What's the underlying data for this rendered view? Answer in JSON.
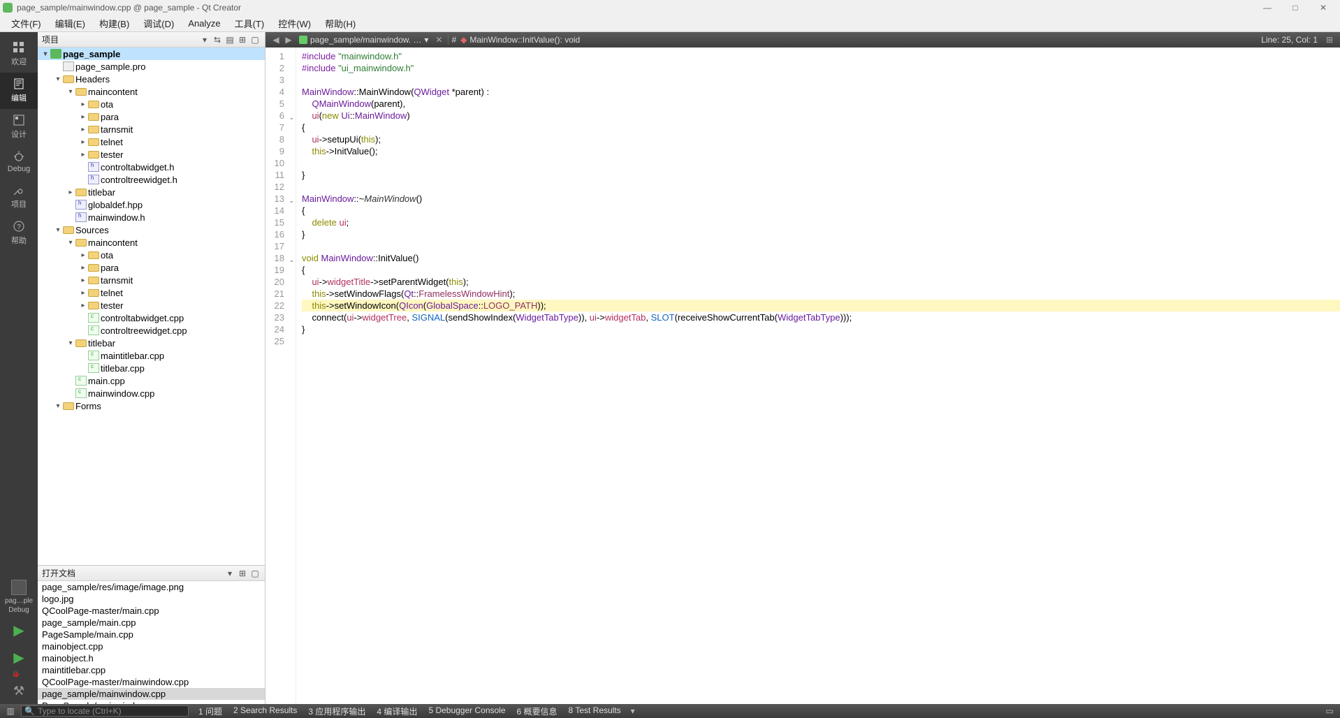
{
  "titlebar": {
    "title": "page_sample/mainwindow.cpp @ page_sample - Qt Creator"
  },
  "menubar": {
    "items": [
      "文件(F)",
      "编辑(E)",
      "构建(B)",
      "调试(D)",
      "Analyze",
      "工具(T)",
      "控件(W)",
      "帮助(H)"
    ]
  },
  "mode_sidebar": {
    "items": [
      {
        "label": "欢迎",
        "icon": "grid"
      },
      {
        "label": "编辑",
        "icon": "edit",
        "active": true
      },
      {
        "label": "设计",
        "icon": "design"
      },
      {
        "label": "Debug",
        "icon": "bug"
      },
      {
        "label": "项目",
        "icon": "wrench"
      },
      {
        "label": "帮助",
        "icon": "help"
      }
    ],
    "kit": {
      "line1": "pag…ple",
      "line2": "",
      "line3": "Debug"
    },
    "run": "run",
    "rundebug": "rundebug",
    "build": "build"
  },
  "project_panel": {
    "title": "项目",
    "tree": [
      {
        "indent": 0,
        "twist": "▾",
        "icon": "proj",
        "label": "page_sample",
        "selected": true
      },
      {
        "indent": 1,
        "twist": "",
        "icon": "pro",
        "label": "page_sample.pro"
      },
      {
        "indent": 1,
        "twist": "▾",
        "icon": "folder",
        "label": "Headers"
      },
      {
        "indent": 2,
        "twist": "▾",
        "icon": "folder",
        "label": "maincontent"
      },
      {
        "indent": 3,
        "twist": "▸",
        "icon": "folder",
        "label": "ota"
      },
      {
        "indent": 3,
        "twist": "▸",
        "icon": "folder",
        "label": "para"
      },
      {
        "indent": 3,
        "twist": "▸",
        "icon": "folder",
        "label": "tarnsmit"
      },
      {
        "indent": 3,
        "twist": "▸",
        "icon": "folder",
        "label": "telnet"
      },
      {
        "indent": 3,
        "twist": "▸",
        "icon": "folder",
        "label": "tester"
      },
      {
        "indent": 3,
        "twist": "",
        "icon": "h",
        "label": "controltabwidget.h"
      },
      {
        "indent": 3,
        "twist": "",
        "icon": "h",
        "label": "controltreewidget.h"
      },
      {
        "indent": 2,
        "twist": "▸",
        "icon": "folder",
        "label": "titlebar"
      },
      {
        "indent": 2,
        "twist": "",
        "icon": "h",
        "label": "globaldef.hpp"
      },
      {
        "indent": 2,
        "twist": "",
        "icon": "h",
        "label": "mainwindow.h"
      },
      {
        "indent": 1,
        "twist": "▾",
        "icon": "folder",
        "label": "Sources"
      },
      {
        "indent": 2,
        "twist": "▾",
        "icon": "folder",
        "label": "maincontent"
      },
      {
        "indent": 3,
        "twist": "▸",
        "icon": "folder",
        "label": "ota"
      },
      {
        "indent": 3,
        "twist": "▸",
        "icon": "folder",
        "label": "para"
      },
      {
        "indent": 3,
        "twist": "▸",
        "icon": "folder",
        "label": "tarnsmit"
      },
      {
        "indent": 3,
        "twist": "▸",
        "icon": "folder",
        "label": "telnet"
      },
      {
        "indent": 3,
        "twist": "▸",
        "icon": "folder",
        "label": "tester"
      },
      {
        "indent": 3,
        "twist": "",
        "icon": "cpp",
        "label": "controltabwidget.cpp"
      },
      {
        "indent": 3,
        "twist": "",
        "icon": "cpp",
        "label": "controltreewidget.cpp"
      },
      {
        "indent": 2,
        "twist": "▾",
        "icon": "folder",
        "label": "titlebar"
      },
      {
        "indent": 3,
        "twist": "",
        "icon": "cpp",
        "label": "maintitlebar.cpp"
      },
      {
        "indent": 3,
        "twist": "",
        "icon": "cpp",
        "label": "titlebar.cpp"
      },
      {
        "indent": 2,
        "twist": "",
        "icon": "cpp",
        "label": "main.cpp"
      },
      {
        "indent": 2,
        "twist": "",
        "icon": "cpp",
        "label": "mainwindow.cpp"
      },
      {
        "indent": 1,
        "twist": "▾",
        "icon": "folder",
        "label": "Forms"
      }
    ]
  },
  "open_docs": {
    "title": "打开文档",
    "items": [
      {
        "label": "page_sample/res/image/image.png"
      },
      {
        "label": "logo.jpg"
      },
      {
        "label": "QCoolPage-master/main.cpp"
      },
      {
        "label": "page_sample/main.cpp"
      },
      {
        "label": "PageSample/main.cpp"
      },
      {
        "label": "mainobject.cpp"
      },
      {
        "label": "mainobject.h"
      },
      {
        "label": "maintitlebar.cpp"
      },
      {
        "label": "QCoolPage-master/mainwindow.cpp"
      },
      {
        "label": "page_sample/mainwindow.cpp",
        "active": true
      },
      {
        "label": "PageSample/mainwindow.cpp"
      }
    ]
  },
  "editor": {
    "crumb_file": "page_sample/mainwindow. …",
    "crumb_sym_prefix": "#",
    "crumb_sym": "MainWindow::InitValue(): void",
    "cursor": "Line: 25, Col: 1",
    "lines": [
      {
        "n": 1,
        "html": "<span class='tok-pre'>#include</span> <span class='tok-str'>\"mainwindow.h\"</span>"
      },
      {
        "n": 2,
        "html": "<span class='tok-pre'>#include</span> <span class='tok-str'>\"ui_mainwindow.h\"</span>"
      },
      {
        "n": 3,
        "html": ""
      },
      {
        "n": 4,
        "html": "<span class='tok-type'>MainWindow</span>::<span class=''>MainWindow</span>(<span class='tok-type'>QWidget</span> *parent) :"
      },
      {
        "n": 5,
        "html": "    <span class='tok-type'>QMainWindow</span>(parent),"
      },
      {
        "n": 6,
        "fold": "v",
        "html": "    <span class='tok-mem'>ui</span>(<span class='tok-kw'>new</span> <span class='tok-type'>Ui</span>::<span class='tok-type'>MainWindow</span>)"
      },
      {
        "n": 7,
        "html": "{"
      },
      {
        "n": 8,
        "html": "    <span class='tok-mem'>ui</span>-&gt;setupUi(<span class='tok-kw'>this</span>);"
      },
      {
        "n": 9,
        "html": "    <span class='tok-kw'>this</span>-&gt;InitValue();"
      },
      {
        "n": 10,
        "html": ""
      },
      {
        "n": 11,
        "html": "}"
      },
      {
        "n": 12,
        "html": ""
      },
      {
        "n": 13,
        "fold": "v",
        "html": "<span class='tok-type'>MainWindow</span>::~<span class='tok-it'>MainWindow</span>()"
      },
      {
        "n": 14,
        "html": "{"
      },
      {
        "n": 15,
        "html": "    <span class='tok-kw'>delete</span> <span class='tok-mem'>ui</span>;"
      },
      {
        "n": 16,
        "html": "}"
      },
      {
        "n": 17,
        "html": ""
      },
      {
        "n": 18,
        "fold": "v",
        "html": "<span class='tok-kw'>void</span> <span class='tok-type'>MainWindow</span>::InitValue()"
      },
      {
        "n": 19,
        "html": "{"
      },
      {
        "n": 20,
        "html": "    <span class='tok-mem'>ui</span>-&gt;<span class='tok-mem'>widgetTitle</span>-&gt;setParentWidget(<span class='tok-kw'>this</span>);"
      },
      {
        "n": 21,
        "html": "    <span class='tok-kw'>this</span>-&gt;setWindowFlags(<span class='tok-type'>Qt</span>::<span class='tok-const'>FramelessWindowHint</span>);"
      },
      {
        "n": 22,
        "hl": true,
        "html": "    <span class='tok-kw'>this</span>-&gt;setWindowIcon(<span class='tok-type'>QIcon</span>(<span class='tok-type'>GlobalSpace</span>::<span class='tok-const'>LOGO_PATH</span>));"
      },
      {
        "n": 23,
        "html": "    connect(<span class='tok-mem'>ui</span>-&gt;<span class='tok-mem'>widgetTree</span>, <span class='tok-hint'>SIGNAL</span>(sendShowIndex(<span class='tok-type'>WidgetTabType</span>)), <span class='tok-mem'>ui</span>-&gt;<span class='tok-mem'>widgetTab</span>, <span class='tok-hint'>SLOT</span>(receiveShowCurrentTab(<span class='tok-type'>WidgetTabType</span>)));"
      },
      {
        "n": 24,
        "html": "}"
      },
      {
        "n": 25,
        "html": ""
      }
    ]
  },
  "statusbar": {
    "locate_placeholder": "Type to locate (Ctrl+K)",
    "panes": [
      "1 问题",
      "2 Search Results",
      "3 应用程序输出",
      "4 编译输出",
      "5 Debugger Console",
      "6 概要信息",
      "8 Test Results"
    ]
  }
}
